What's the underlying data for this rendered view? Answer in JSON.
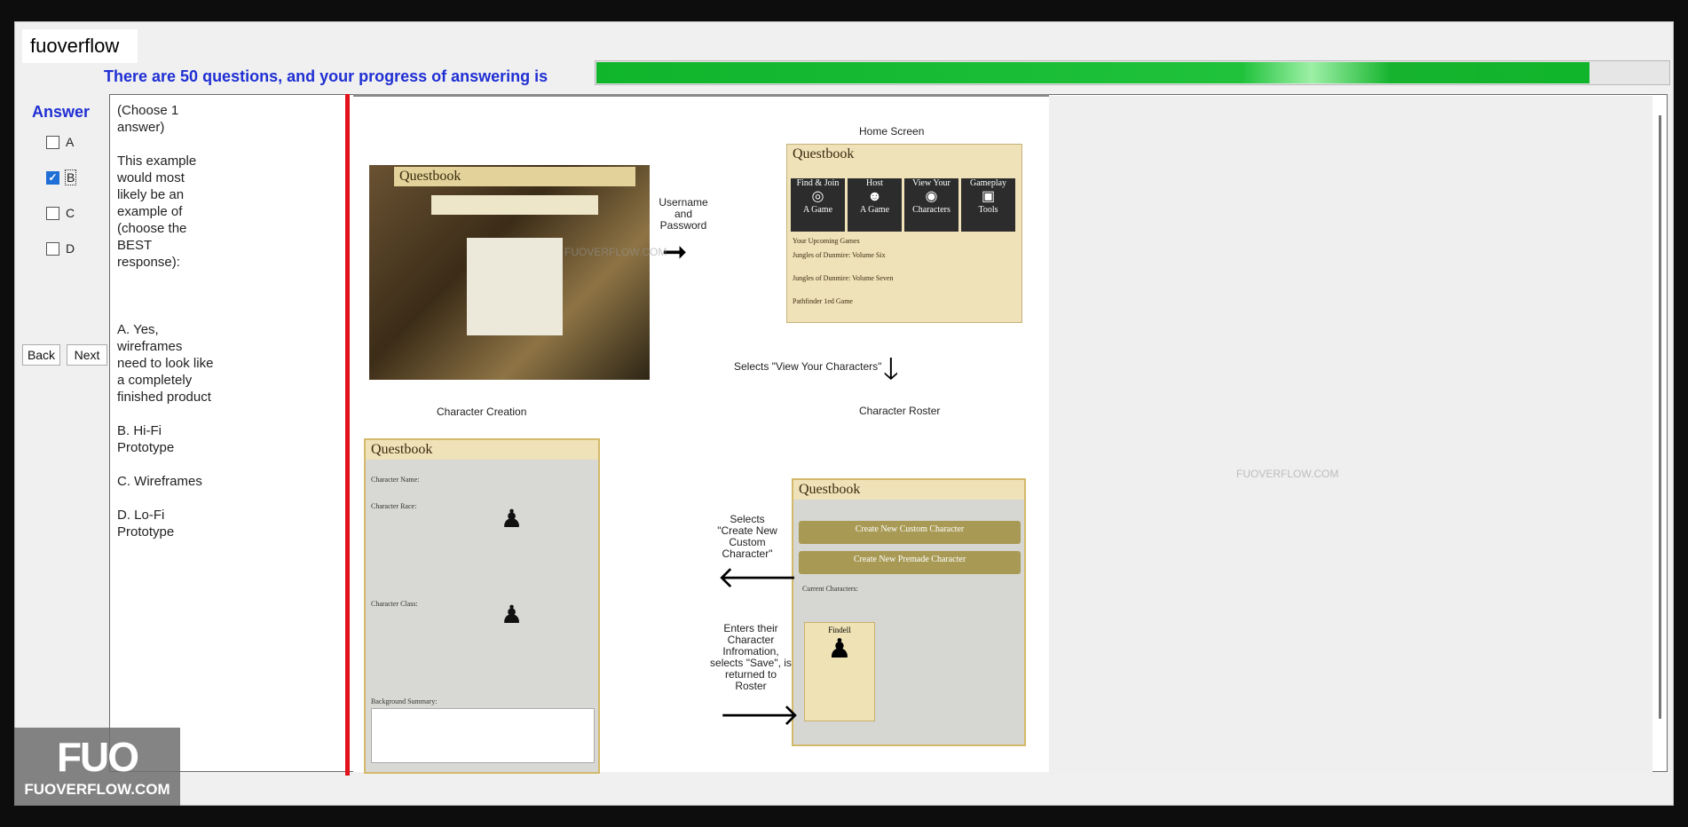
{
  "app": {
    "title": "fuoverflow"
  },
  "progress": {
    "label": "There are 50 questions, and your progress of answering is",
    "value": 0.925,
    "fill_color": "#10b52c"
  },
  "answer": {
    "title": "Answer",
    "options": [
      {
        "label": "A",
        "checked": false
      },
      {
        "label": "B",
        "checked": true
      },
      {
        "label": "C",
        "checked": false
      },
      {
        "label": "D",
        "checked": false
      }
    ]
  },
  "nav": {
    "back_label": "Back",
    "next_label": "Next"
  },
  "question": {
    "instruction": "(Choose 1 answer)",
    "prompt": "This example would most likely be an example of (choose the BEST response):",
    "choices": [
      "A.  Yes, wireframes need to look like a completely finished product",
      "B.  Hi-Fi Prototype",
      "C.  Wireframes",
      "D.  Lo-Fi Prototype"
    ]
  },
  "diagram": {
    "home_screen_caption": "Home Screen",
    "username_caption": "Username and Password",
    "view_characters_caption": "Selects \"View Your Characters\"",
    "character_roster_caption": "Character Roster",
    "character_creation_caption": "Character Creation",
    "create_custom_caption": "Selects \"Create New Custom Character\"",
    "enters_info_caption": "Enters their Character Infromation, selects \"Save\", is returned to Roster",
    "app_name": "Questbook",
    "home_tiles": [
      {
        "top": "Find & Join",
        "bottom": "A Game"
      },
      {
        "top": "Host",
        "bottom": "A Game"
      },
      {
        "top": "View Your",
        "bottom": "Characters"
      },
      {
        "top": "Gameplay",
        "bottom": "Tools"
      }
    ],
    "roster_buttons": [
      "Create New Custom Character",
      "Create New Premade Character"
    ],
    "character_name": "Findell",
    "character_name_field": "Character Name:",
    "character_race_field": "Character Race:",
    "character_class_field": "Character Class:",
    "background_field": "Background Summary:",
    "upcoming_games_label": "Your Upcoming Games",
    "upcoming_games": [
      "Jungles of Dunmire: Volume Six",
      "Jungles of Dunmire: Volume Seven",
      "Pathfinder 1ed Game"
    ],
    "current_characters_label": "Current Characters:"
  },
  "watermark": {
    "logo": "FUO",
    "site": "FUOVERFLOW.COM"
  },
  "icons": {
    "check": "check-icon",
    "arrow_right": "arrow-right-icon",
    "arrow_down": "arrow-down-icon",
    "arrow_left": "arrow-left-icon"
  }
}
